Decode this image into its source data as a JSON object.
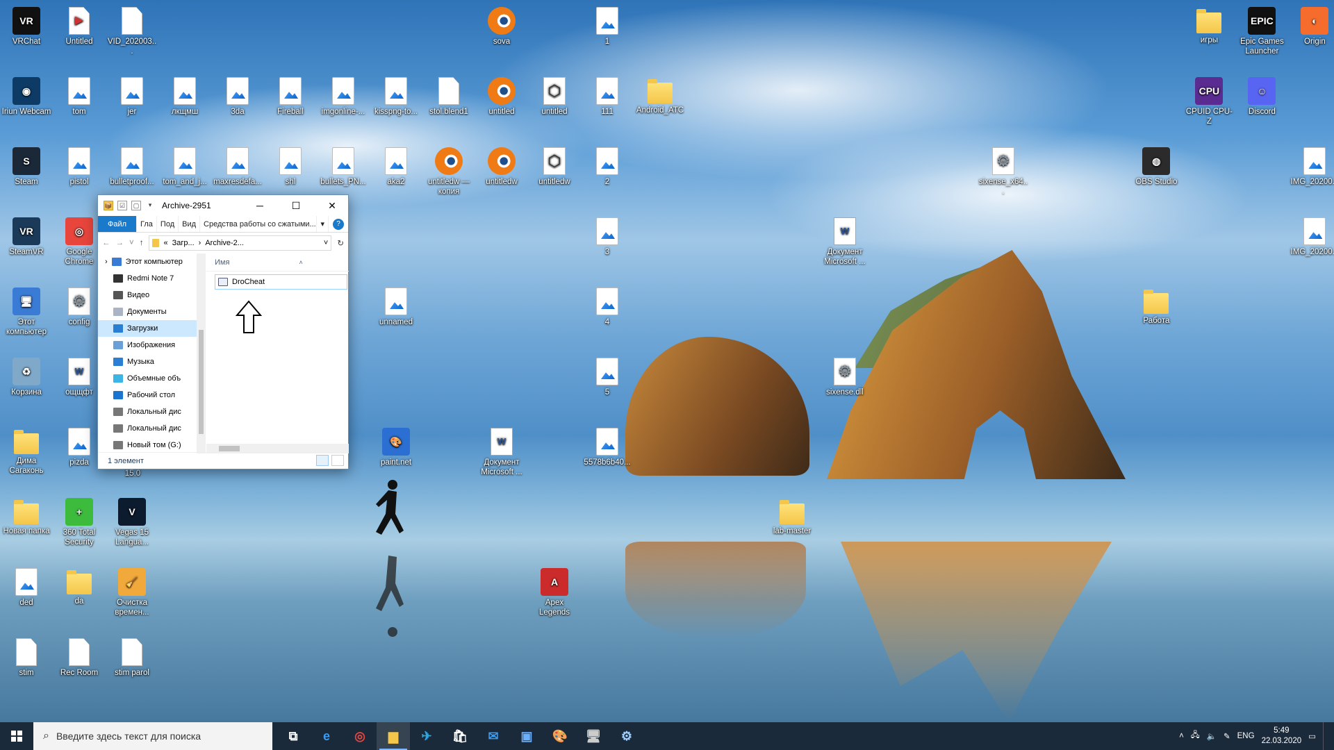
{
  "desktop": {
    "icons": [
      {
        "id": "vrchat",
        "label": "VRChat",
        "type": "app",
        "glyph": "VR",
        "color": "#111111",
        "col": 0,
        "row": 0
      },
      {
        "id": "untitled-video",
        "label": "Untitled",
        "type": "video",
        "glyph": "▶",
        "color": "#ffffff",
        "col": 1,
        "row": 0
      },
      {
        "id": "vid",
        "label": "VID_202003...",
        "type": "file",
        "col": 2,
        "row": 0
      },
      {
        "id": "sova",
        "label": "sova",
        "type": "blender",
        "col": 9,
        "row": 0
      },
      {
        "id": "img-1",
        "label": "1",
        "type": "image",
        "col": 11,
        "row": 0
      },
      {
        "id": "igry",
        "label": "игры",
        "type": "folder",
        "col": 22.4,
        "row": 0
      },
      {
        "id": "epic",
        "label": "Epic Games Launcher",
        "type": "app",
        "glyph": "EPIC",
        "color": "#111111",
        "col": 23.4,
        "row": 0
      },
      {
        "id": "origin",
        "label": "Origin",
        "type": "app",
        "glyph": "◐",
        "color": "#f56c2d",
        "col": 24.4,
        "row": 0
      },
      {
        "id": "iriun",
        "label": "Iriun Webcam",
        "type": "app",
        "glyph": "◉",
        "color": "#0d3b66",
        "col": 0,
        "row": 1
      },
      {
        "id": "tom",
        "label": "tom",
        "type": "image",
        "col": 1,
        "row": 1
      },
      {
        "id": "jer",
        "label": "jer",
        "type": "image",
        "col": 2,
        "row": 1
      },
      {
        "id": "lkshmsh",
        "label": "лкщмш",
        "type": "image",
        "col": 3,
        "row": 1
      },
      {
        "id": "3da",
        "label": "3da",
        "type": "image",
        "col": 4,
        "row": 1
      },
      {
        "id": "fireball",
        "label": "Fireball",
        "type": "image",
        "col": 5,
        "row": 1
      },
      {
        "id": "imgonline",
        "label": "imgonline-...",
        "type": "image",
        "col": 6,
        "row": 1
      },
      {
        "id": "kisspng",
        "label": "kisspng-to...",
        "type": "image",
        "col": 7,
        "row": 1
      },
      {
        "id": "stol",
        "label": "stol.blend1",
        "type": "file",
        "col": 8,
        "row": 1
      },
      {
        "id": "untitled-b1",
        "label": "untitled",
        "type": "blender",
        "col": 9,
        "row": 1
      },
      {
        "id": "untitled-c1",
        "label": "untitled",
        "type": "cube",
        "col": 10,
        "row": 1
      },
      {
        "id": "img-111",
        "label": "111",
        "type": "image",
        "col": 11,
        "row": 1
      },
      {
        "id": "android",
        "label": "Android_ATC",
        "type": "folder",
        "col": 12,
        "row": 1
      },
      {
        "id": "cpuz",
        "label": "CPUID CPU-Z",
        "type": "app",
        "glyph": "CPU",
        "color": "#5a2c91",
        "col": 22.4,
        "row": 1
      },
      {
        "id": "discord",
        "label": "Discord",
        "type": "app",
        "glyph": "☺",
        "color": "#5865f2",
        "col": 23.4,
        "row": 1
      },
      {
        "id": "steam",
        "label": "Steam",
        "type": "app",
        "glyph": "S",
        "color": "#1b2838",
        "col": 0,
        "row": 2
      },
      {
        "id": "pistol",
        "label": "pistol",
        "type": "image",
        "col": 1,
        "row": 2
      },
      {
        "id": "bulletproof",
        "label": "bulletproof...",
        "type": "image",
        "col": 2,
        "row": 2
      },
      {
        "id": "tom-and-j",
        "label": "tom_and_j...",
        "type": "image",
        "col": 3,
        "row": 2
      },
      {
        "id": "maxresdefa",
        "label": "maxresdefa...",
        "type": "image",
        "col": 4,
        "row": 2
      },
      {
        "id": "shl",
        "label": "shl",
        "type": "image",
        "col": 5,
        "row": 2
      },
      {
        "id": "bullets-pn",
        "label": "bullets_PN...",
        "type": "image",
        "col": 6,
        "row": 2
      },
      {
        "id": "aka2",
        "label": "aka2",
        "type": "image",
        "col": 7,
        "row": 2
      },
      {
        "id": "untitledw-kopia",
        "label": "untitledw — копия",
        "type": "blender",
        "col": 8,
        "row": 2
      },
      {
        "id": "untitledw-b",
        "label": "untitledw",
        "type": "blender",
        "col": 9,
        "row": 2
      },
      {
        "id": "untitledw-c",
        "label": "untitledw",
        "type": "cube",
        "col": 10,
        "row": 2
      },
      {
        "id": "img-2",
        "label": "2",
        "type": "image",
        "col": 11,
        "row": 2
      },
      {
        "id": "sixense-x64",
        "label": "sixense_x64...",
        "type": "gear",
        "col": 18.5,
        "row": 2
      },
      {
        "id": "obs",
        "label": "OBS Studio",
        "type": "app",
        "glyph": "◍",
        "color": "#2b2b2b",
        "col": 21.4,
        "row": 2
      },
      {
        "id": "img-2020-1",
        "label": "IMG_20200...",
        "type": "image",
        "col": 24.4,
        "row": 2
      },
      {
        "id": "steamvr",
        "label": "SteamVR",
        "type": "app",
        "glyph": "VR",
        "color": "#1b3a5a",
        "col": 0,
        "row": 3
      },
      {
        "id": "chrome",
        "label": "Google Chrome",
        "type": "app",
        "glyph": "◎",
        "color": "#e8453c",
        "col": 1,
        "row": 3
      },
      {
        "id": "img-3",
        "label": "3",
        "type": "image",
        "col": 11,
        "row": 3
      },
      {
        "id": "doc-ms-1",
        "label": "Документ Microsoft ...",
        "type": "word",
        "col": 15.5,
        "row": 3
      },
      {
        "id": "img-2020-2",
        "label": "IMG_20200...",
        "type": "image",
        "col": 24.4,
        "row": 3
      },
      {
        "id": "this-pc",
        "label": "Этот компьютер",
        "type": "app",
        "glyph": "🖥",
        "color": "#3a7bd5",
        "col": 0,
        "row": 4
      },
      {
        "id": "config",
        "label": "config",
        "type": "gear",
        "col": 1,
        "row": 4
      },
      {
        "id": "unnamed",
        "label": "unnamed",
        "type": "image",
        "col": 7,
        "row": 4
      },
      {
        "id": "img-4",
        "label": "4",
        "type": "image",
        "col": 11,
        "row": 4
      },
      {
        "id": "rabota",
        "label": "Работа",
        "type": "folder",
        "col": 21.4,
        "row": 4
      },
      {
        "id": "recycle",
        "label": "Корзина",
        "type": "app",
        "glyph": "♻",
        "color": "#7fa8c9",
        "col": 0,
        "row": 5
      },
      {
        "id": "oshchft",
        "label": "ощщфт",
        "type": "word",
        "col": 1,
        "row": 5
      },
      {
        "id": "img-5",
        "label": "5",
        "type": "image",
        "col": 11,
        "row": 5
      },
      {
        "id": "sixense-dll",
        "label": "sixense.dll",
        "type": "gear",
        "col": 15.5,
        "row": 5
      },
      {
        "id": "dima",
        "label": "Дима Сагаконь",
        "type": "folder",
        "col": 0,
        "row": 6
      },
      {
        "id": "pizda",
        "label": "pizda",
        "type": "image",
        "col": 1,
        "row": 6
      },
      {
        "id": "paintnet",
        "label": "paint.net",
        "type": "app",
        "glyph": "🎨",
        "color": "#2a6fd1",
        "col": 7,
        "row": 6
      },
      {
        "id": "doc-ms-2",
        "label": "Документ Microsoft ...",
        "type": "word",
        "col": 9,
        "row": 6
      },
      {
        "id": "img-5578",
        "label": "5578b6b40...",
        "type": "image",
        "col": 11,
        "row": 6
      },
      {
        "id": "new-folder",
        "label": "Новая папка",
        "type": "folder",
        "col": 0,
        "row": 7
      },
      {
        "id": "360",
        "label": "360 Total Security",
        "type": "app",
        "glyph": "+",
        "color": "#3dbb3d",
        "col": 1,
        "row": 7
      },
      {
        "id": "vegas",
        "label": "Vegas 15 Langua...",
        "type": "app",
        "glyph": "V",
        "color": "#0c1b2e",
        "col": 2,
        "row": 7
      },
      {
        "id": "lab-master",
        "label": "lab-master",
        "type": "folder",
        "col": 14.5,
        "row": 7
      },
      {
        "id": "ded",
        "label": "ded",
        "type": "image",
        "col": 0,
        "row": 8
      },
      {
        "id": "da",
        "label": "da",
        "type": "folder",
        "col": 1,
        "row": 8
      },
      {
        "id": "cleanup",
        "label": "Очистка времен...",
        "type": "app",
        "glyph": "🧹",
        "color": "#f2a93b",
        "col": 2,
        "row": 8
      },
      {
        "id": "apex",
        "label": "Apex Legends",
        "type": "app",
        "glyph": "A",
        "color": "#cc2b2b",
        "col": 10,
        "row": 8
      },
      {
        "id": "stim",
        "label": "stim",
        "type": "file",
        "col": 0,
        "row": 9
      },
      {
        "id": "recroom",
        "label": "Rec Room",
        "type": "file",
        "col": 1,
        "row": 9
      },
      {
        "id": "stim-parol",
        "label": "stim parol",
        "type": "file",
        "col": 2,
        "row": 9
      }
    ],
    "stray_label": "15.0"
  },
  "explorer": {
    "title": "Archive-2951",
    "quick_access": [
      "📦",
      "☑",
      "▢",
      "▾"
    ],
    "ribbon_tabs": [
      "Файл",
      "Гла",
      "Под",
      "Вид"
    ],
    "context_tab": "Средства работы со сжатыми...",
    "address_path": [
      "«",
      "Загр...",
      "›",
      "Archive-2..."
    ],
    "nav": [
      {
        "label": "Этот компьютер",
        "color": "#3a7bd5",
        "root": true
      },
      {
        "label": "Redmi Note 7",
        "color": "#333333"
      },
      {
        "label": "Видео",
        "color": "#555555"
      },
      {
        "label": "Документы",
        "color": "#aab4c4"
      },
      {
        "label": "Загрузки",
        "color": "#2a7fd4",
        "selected": true
      },
      {
        "label": "Изображения",
        "color": "#6aa0d8"
      },
      {
        "label": "Музыка",
        "color": "#2a7fd4"
      },
      {
        "label": "Объемные объ",
        "color": "#3cb4e6"
      },
      {
        "label": "Рабочий стол",
        "color": "#1a75d1"
      },
      {
        "label": "Локальный дис",
        "color": "#777777"
      },
      {
        "label": "Локальный дис",
        "color": "#777777"
      },
      {
        "label": "Новый том (G:)",
        "color": "#777777"
      }
    ],
    "column_name": "Имя",
    "files": [
      {
        "label": "DroCheat"
      }
    ],
    "status": "1 элемент"
  },
  "taskbar": {
    "search_placeholder": "Введите здесь текст для поиска",
    "apps": [
      {
        "name": "task-view-icon",
        "glyph": "⧉",
        "color": "#ffffff"
      },
      {
        "name": "edge-icon",
        "glyph": "e",
        "color": "#3a9cf0"
      },
      {
        "name": "chrome-icon",
        "glyph": "◎",
        "color": "#e8453c"
      },
      {
        "name": "file-explorer-icon",
        "glyph": "▆",
        "color": "#f4c64a",
        "active": true
      },
      {
        "name": "telegram-icon",
        "glyph": "✈",
        "color": "#2ca5e0"
      },
      {
        "name": "store-icon",
        "glyph": "🛍",
        "color": "#ffffff"
      },
      {
        "name": "mail-icon",
        "glyph": "✉",
        "color": "#3a9cf0"
      },
      {
        "name": "app-icon",
        "glyph": "▣",
        "color": "#6ab0ff"
      },
      {
        "name": "paintnet-icon",
        "glyph": "🎨",
        "color": "#ffffff"
      },
      {
        "name": "pc-icon",
        "glyph": "🖥",
        "color": "#cccccc"
      },
      {
        "name": "settings-app-icon",
        "glyph": "⚙",
        "color": "#9fd0ff"
      }
    ],
    "tray": {
      "lang": "ENG",
      "time": "5:49",
      "date": "22.03.2020"
    }
  }
}
